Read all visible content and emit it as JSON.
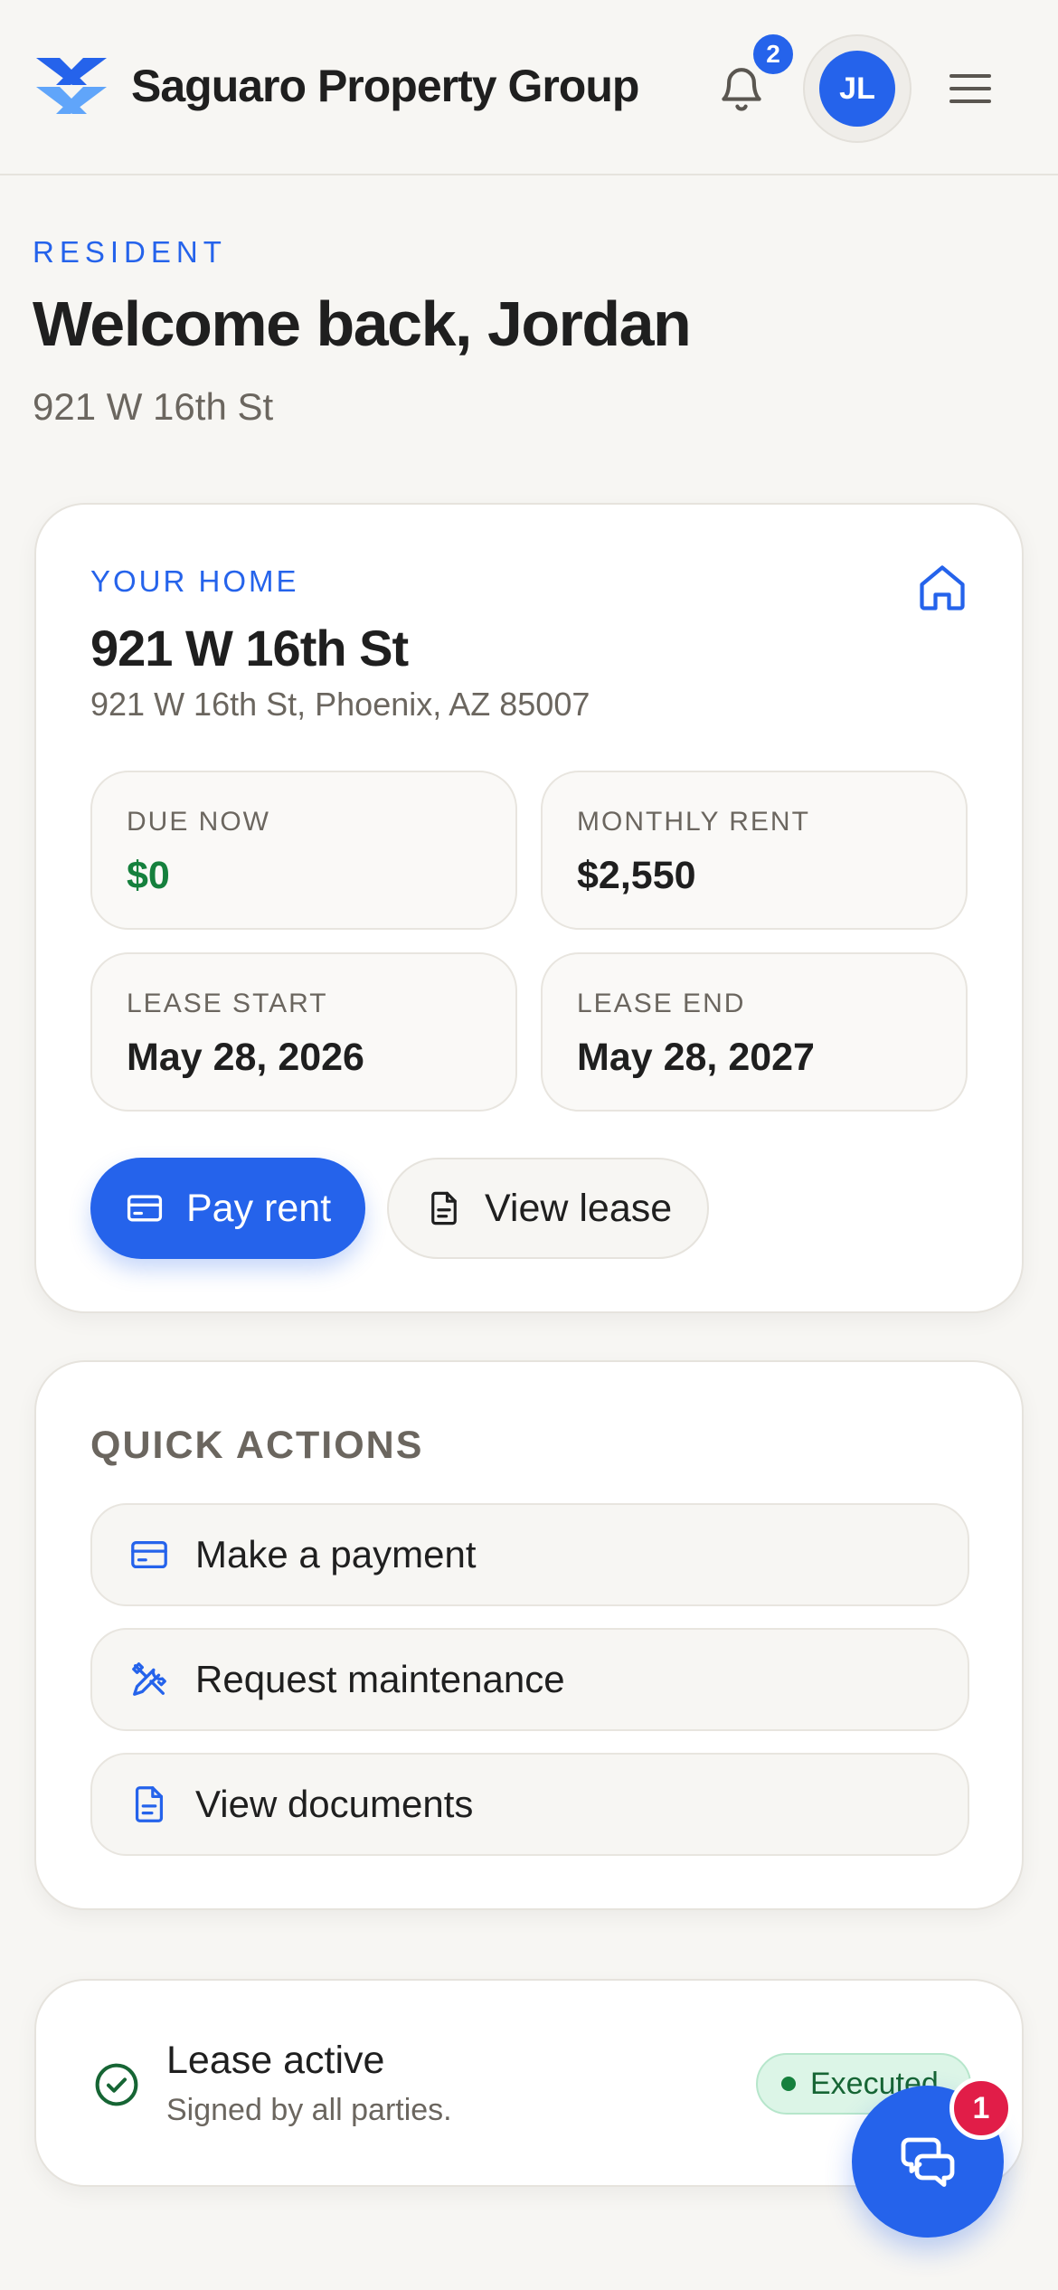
{
  "header": {
    "brand": "Saguaro Property Group",
    "notification_count": "2",
    "avatar_initials": "JL"
  },
  "welcome": {
    "eyebrow": "RESIDENT",
    "title": "Welcome back, Jordan",
    "address": "921 W 16th St"
  },
  "home": {
    "label": "YOUR HOME",
    "title": "921 W 16th St",
    "address": "921 W 16th St, Phoenix, AZ 85007",
    "stats": [
      {
        "label": "DUE NOW",
        "value": "$0"
      },
      {
        "label": "MONTHLY RENT",
        "value": "$2,550"
      },
      {
        "label": "LEASE START",
        "value": "May 28, 2026"
      },
      {
        "label": "LEASE END",
        "value": "May 28, 2027"
      }
    ],
    "pay_label": "Pay rent",
    "lease_label": "View lease"
  },
  "quick_actions": {
    "title": "QUICK ACTIONS",
    "items": [
      {
        "label": "Make a payment",
        "icon": "credit-card-icon"
      },
      {
        "label": "Request maintenance",
        "icon": "tools-icon"
      },
      {
        "label": "View documents",
        "icon": "document-icon"
      }
    ]
  },
  "lease_status": {
    "title": "Lease active",
    "subtitle": "Signed by all parties.",
    "badge": "Executed"
  },
  "chat": {
    "unread_count": "1"
  },
  "colors": {
    "accent": "#2563eb",
    "success": "#15803d",
    "alert": "#e11d48",
    "background": "#f7f6f3"
  }
}
